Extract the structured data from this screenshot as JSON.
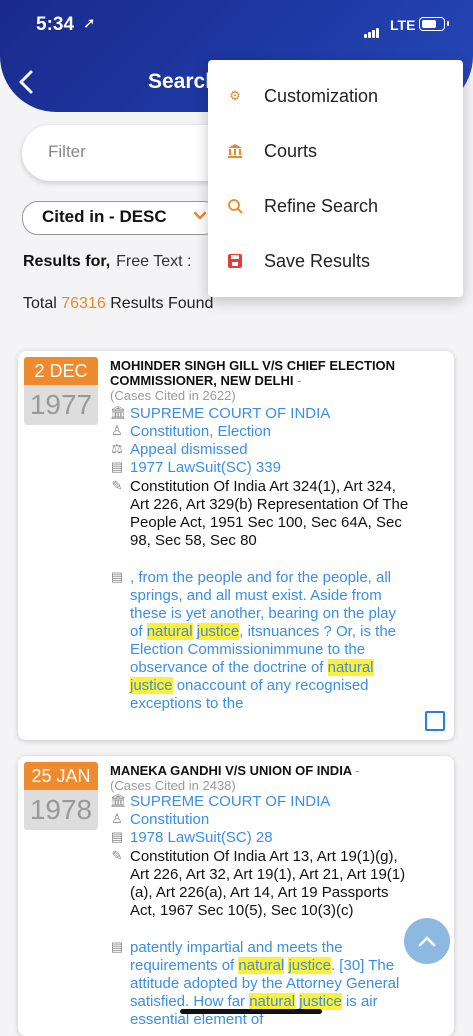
{
  "status": {
    "time": "5:34",
    "carrier": "LTE"
  },
  "header": {
    "title": "Search"
  },
  "filter": {
    "placeholder": "Filter"
  },
  "sort": {
    "label": "Cited in - DESC"
  },
  "results": {
    "for_label": "Results for,",
    "free_text": "Free Text :",
    "total_prefix": "Total",
    "count": "76316",
    "total_suffix": "Results Found"
  },
  "menu": {
    "items": [
      {
        "label": "Customization",
        "icon": "gear-icon"
      },
      {
        "label": "Courts",
        "icon": "court-icon"
      },
      {
        "label": "Refine Search",
        "icon": "search-refine-icon"
      },
      {
        "label": "Save Results",
        "icon": "save-icon"
      }
    ]
  },
  "cases": [
    {
      "date": "2 DEC",
      "year": "1977",
      "title": "MOHINDER SINGH GILL V/S CHIEF ELECTION COMMISSIONER, NEW DELHI",
      "dash": "-",
      "cited": "(Cases Cited in 2622)",
      "court": "SUPREME COURT OF INDIA",
      "subject": "Constitution, Election",
      "result": "Appeal dismissed",
      "citation": "1977 LawSuit(SC) 339",
      "acts": "Constitution Of India  Art 324(1), Art 324, Art 226, Art 329(b) Representation Of The People Act, 1951  Sec 100, Sec 64A, Sec 98, Sec 58, Sec 80",
      "excerpt": [
        ", from the people and for the people, all springs, and all must exist. Aside from these is yet another, bearing on the play of ",
        "natural",
        " ",
        "justice",
        ", itsnuances ? Or, is the Election Commissionimmune to the observance of the doctrine of ",
        "natural",
        " ",
        "justice",
        " onaccount of any recognised exceptions to the"
      ]
    },
    {
      "date": "25 JAN",
      "year": "1978",
      "title": "MANEKA GANDHI V/S UNION OF INDIA",
      "dash": "-",
      "cited": "(Cases Cited in 2438)",
      "court": "SUPREME COURT OF INDIA",
      "subject": "Constitution",
      "citation": "1978 LawSuit(SC) 28",
      "acts": "Constitution Of India  Art 13, Art 19(1)(g), Art 226, Art 32, Art 19(1), Art 21, Art 19(1)(a), Art 226(a), Art 14, Art 19 Passports Act, 1967  Sec 10(5), Sec 10(3)(c)",
      "excerpt": [
        "patently impartial and meets the requirements of ",
        "natural",
        " ",
        "justice",
        ". [30] The attitude adopted by the Attorney General satisfied. How far ",
        "natural",
        " ",
        "justice",
        " is air essential element of"
      ]
    }
  ]
}
